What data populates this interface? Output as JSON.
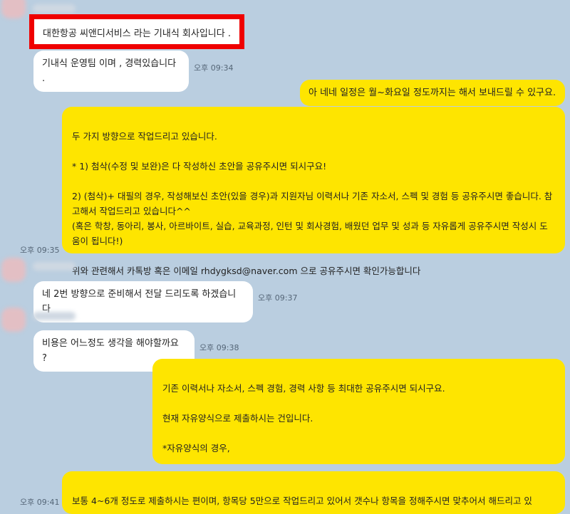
{
  "messages": [
    {
      "text": "대한항공 씨앤디서비스 라는 기내식 회사입니다 ."
    },
    {
      "text": "기내식 운영팀 이며 , 경력있습니다 .",
      "time": "오후 09:34"
    },
    {
      "text": "아 네네 일정은 월~화요일 정도까지는 해서 보내드릴 수 있구요."
    },
    {
      "text": "두 가지 방향으로 작업드리고 있습니다.\n\n* 1) 첨삭(수정 및 보완)은 다 작성하신 초안을 공유주시면 되시구요!\n\n2) (첨삭)+ 대필의 경우, 작성해보신 초안(있을 경우)과 지원자님 이력서나 기존 자소서, 스펙 및 경험 등 공유주시면 좋습니다. 참고해서 작업드리고 있습니다^^\n(혹은 학창, 동아리, 봉사, 아르바이트, 실습, 교육과정, 인턴 및 회사경험, 배웠던 업무 및 성과 등 자유롭게 공유주시면 작성시 도움이 됩니다!)\n\n위와 관련해서 카톡방 혹은 이메일 rhdygksd@naver.com 으로 공유주시면 확인가능합니다",
      "time": "오후 09:35"
    },
    {
      "text": "네 2번 방향으로 준비해서 전달 드리도록 하겠습니다",
      "time": "오후 09:37"
    },
    {
      "text": "비용은 어느정도 생각을 해야할까요 ?",
      "time": "오후 09:38"
    },
    {
      "text": "기존 이력서나 자소서, 스펙 경험, 경력 사항 등 최대한 공유주시면 되시구요.\n\n현재 자유양식으로 제출하시는 건입니다.\n\n*자유양식의 경우,\n\n*성장과정 및 학창시절, 장단점, 지원동기, 입사 후 포부, 가치관 및 생활신조 // +@ 직무 및 관련 경험,"
    },
    {
      "text": "보통 4~6개 정도로 제출하시는 편이며, 항목당 5만으로 작업드리고 있어서 갯수나 항목을 정해주시면 맞추어서 해드리고 있",
      "time": "오후 09:41"
    }
  ]
}
